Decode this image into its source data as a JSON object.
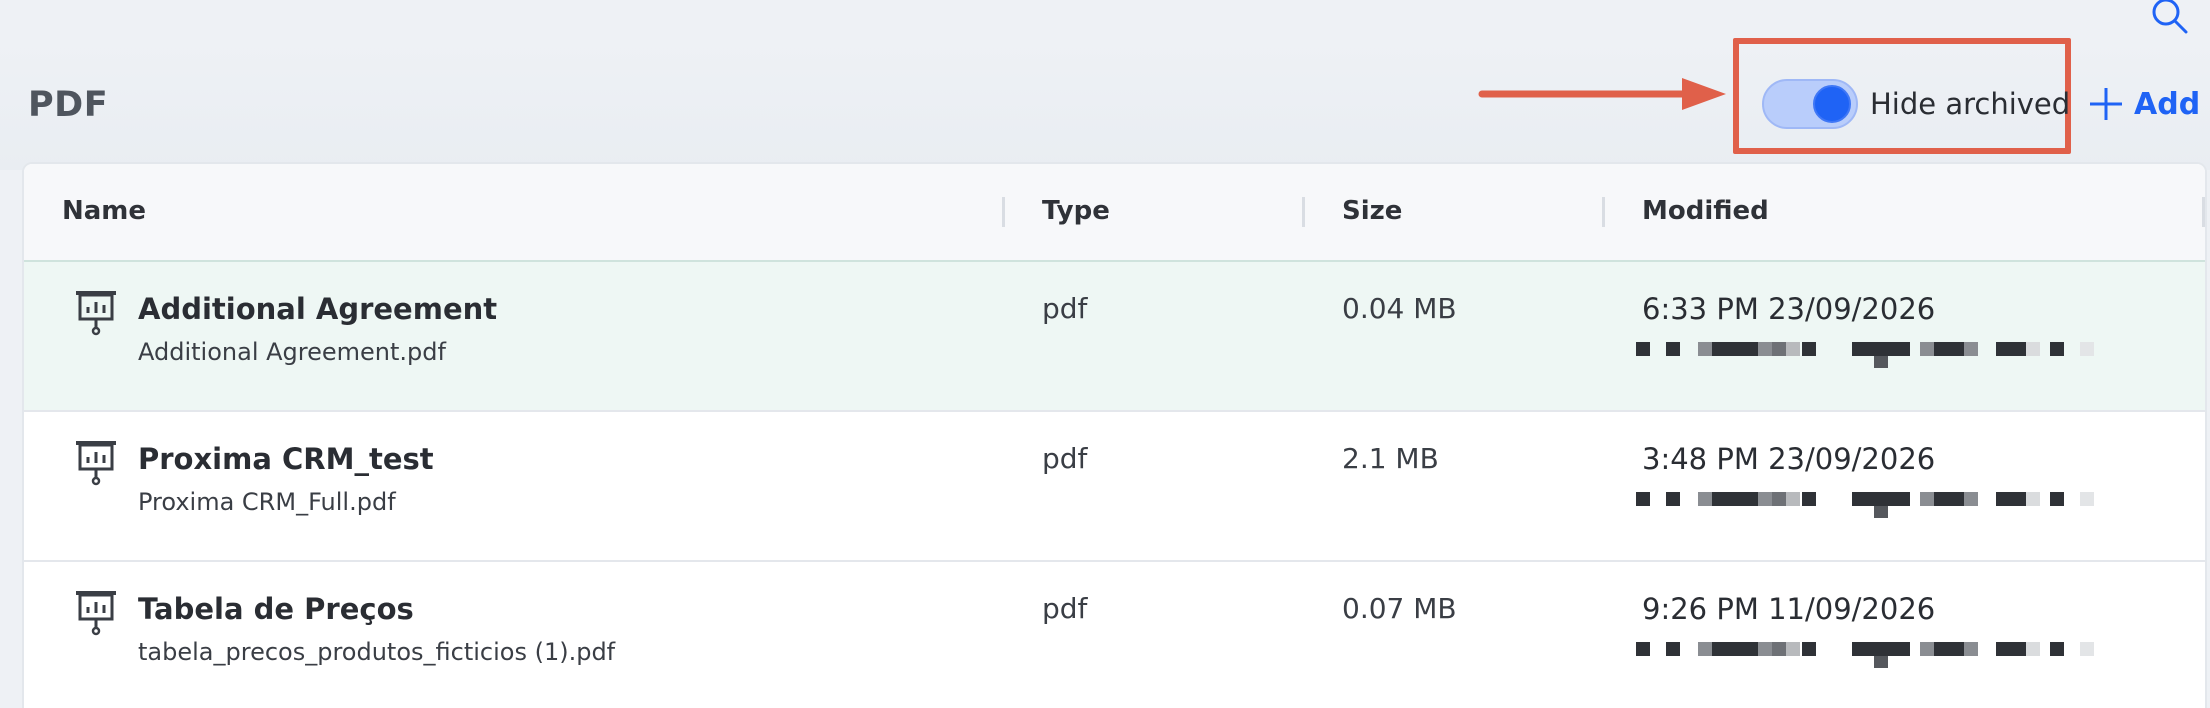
{
  "header": {
    "title": "PDF",
    "hide_archived_label": "Hide archived",
    "hide_archived_on": true,
    "add_label": "Add"
  },
  "colors": {
    "accent": "#1f63f5",
    "callout": "#e0604a",
    "selected_row": "#eef7f4"
  },
  "icons": {
    "search": "search-icon",
    "add": "plus-icon",
    "document": "presentation-chart-icon"
  },
  "table": {
    "columns": [
      "Name",
      "Type",
      "Size",
      "Modified"
    ],
    "rows": [
      {
        "title": "Additional Agreement",
        "file": "Additional Agreement.pdf",
        "type": "pdf",
        "size": "0.04 MB",
        "modified": "6:33 PM 23/09/2026",
        "selected": true
      },
      {
        "title": "Proxima CRM_test",
        "file": "Proxima CRM_Full.pdf",
        "type": "pdf",
        "size": "2.1 MB",
        "modified": "3:48 PM 23/09/2026",
        "selected": false
      },
      {
        "title": "Tabela de Preços",
        "file": "tabela_precos_produtos_ficticios (1).pdf",
        "type": "pdf",
        "size": "0.07 MB",
        "modified": "9:26 PM 11/09/2026",
        "selected": false
      }
    ]
  }
}
